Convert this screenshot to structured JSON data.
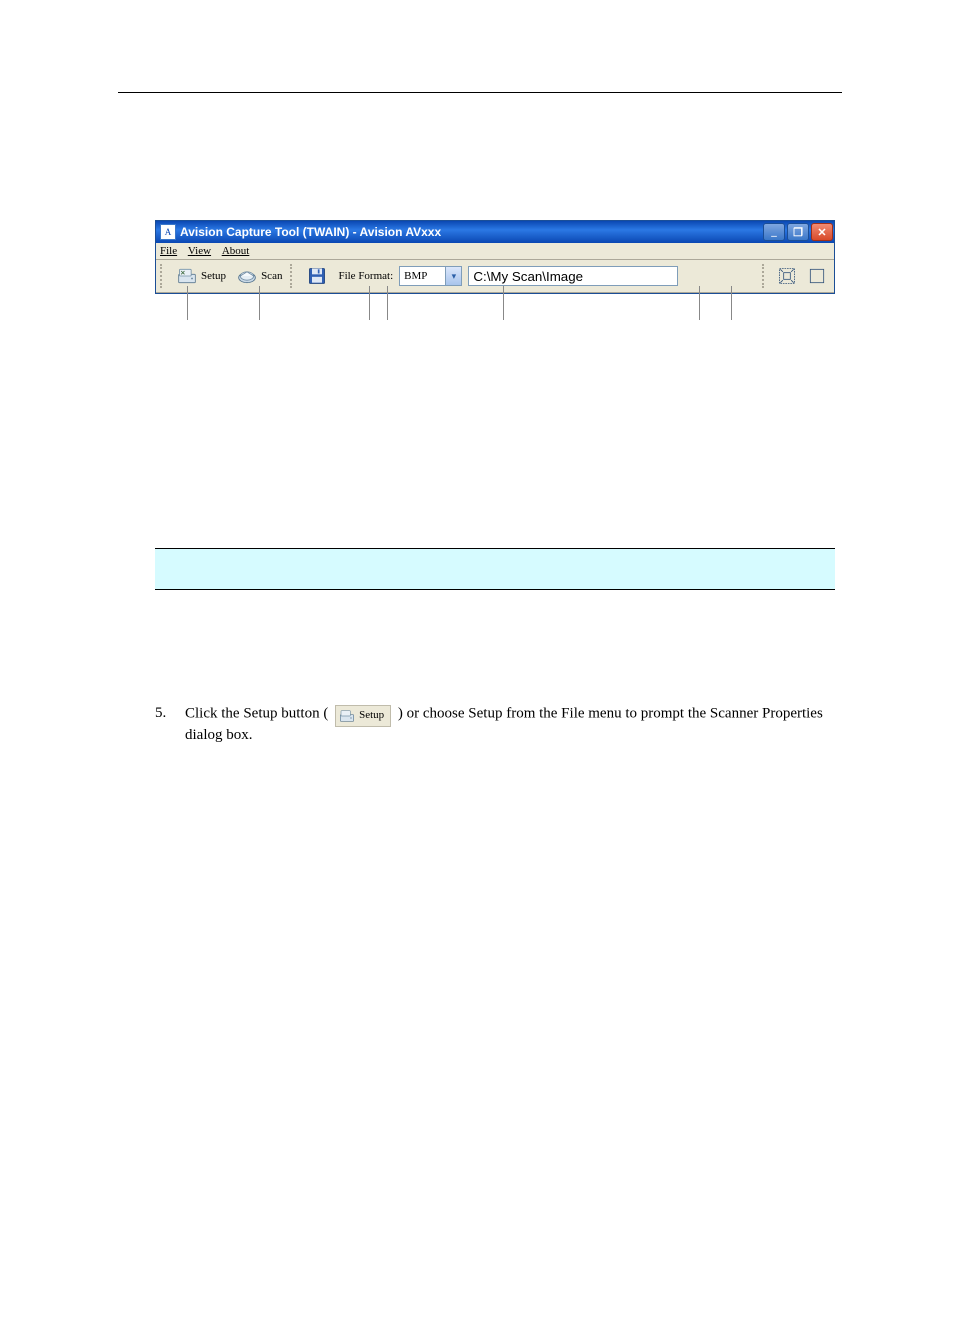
{
  "header": {
    "left": "",
    "right": ""
  },
  "intro": "",
  "window": {
    "title": "Avision Capture Tool (TWAIN) - Avision AVxxx",
    "menus": {
      "file": "File",
      "view": "View",
      "about": "About"
    },
    "toolbar": {
      "setup_label": "Setup",
      "scan_label": "Scan",
      "file_format_label": "File Format:",
      "file_format_value": "BMP",
      "path_value": "C:\\My Scan\\Image"
    },
    "winbtns": {
      "min": "_",
      "max": "❐",
      "close": "✕"
    }
  },
  "callouts": {
    "setup": "",
    "scan": "",
    "fformat": "",
    "save": "",
    "path": "",
    "fit": "",
    "actual": ""
  },
  "note": {
    "head": "",
    "body": ""
  },
  "step5": {
    "num": "5.",
    "before": "Click the Setup button (",
    "btn_label": "Setup",
    "after": ") or choose Setup from the File menu to prompt the Scanner Properties dialog box."
  },
  "page_num": ""
}
